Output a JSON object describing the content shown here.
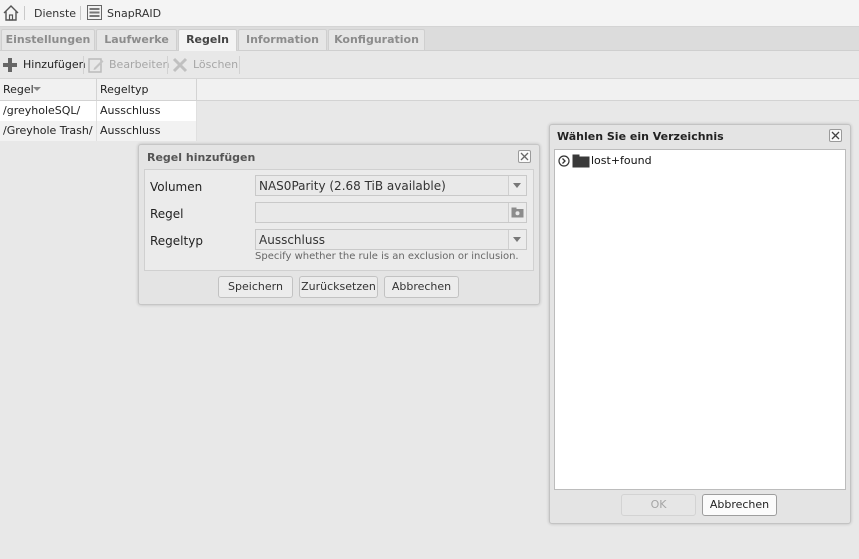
{
  "topbar": {
    "home_icon": "home-icon",
    "breadcrumbs": [
      "Dienste",
      "SnapRAID"
    ],
    "snapraid_icon": "snapraid-icon"
  },
  "tabs": [
    {
      "label": "Einstellungen",
      "active": false
    },
    {
      "label": "Laufwerke",
      "active": false
    },
    {
      "label": "Regeln",
      "active": true
    },
    {
      "label": "Information",
      "active": false
    },
    {
      "label": "Konfiguration",
      "active": false
    }
  ],
  "toolbar": {
    "add_label": "Hinzufügen",
    "edit_label": "Bearbeiten",
    "delete_label": "Löschen",
    "edit_disabled": true,
    "delete_disabled": true
  },
  "grid": {
    "columns": [
      "Regel",
      "Regeltyp"
    ],
    "sort_column": "Regel",
    "rows": [
      [
        "/greyholeSQL/",
        "Ausschluss"
      ],
      [
        "/Greyhole Trash/",
        "Ausschluss"
      ]
    ]
  },
  "add_rule_dialog": {
    "title": "Regel hinzufügen",
    "fields": {
      "volume_label": "Volumen",
      "volume_value": "NAS0Parity (2.68 TiB available)",
      "rule_label": "Regel",
      "rule_value": "",
      "ruletype_label": "Regeltyp",
      "ruletype_value": "Ausschluss",
      "ruletype_hint": "Specify whether the rule is an exclusion or inclusion."
    },
    "buttons": {
      "save": "Speichern",
      "reset": "Zurücksetzen",
      "cancel": "Abbrechen"
    }
  },
  "dir_dialog": {
    "title": "Wählen Sie ein Verzeichnis",
    "tree": [
      {
        "name": "lost+found",
        "expanded": false
      }
    ],
    "buttons": {
      "ok": "OK",
      "cancel": "Abbrechen",
      "ok_disabled": true
    }
  },
  "colors": {
    "background": "#e8e8e8",
    "active_tab_text": "#444444",
    "inactive_tab_text": "#8c8c8c",
    "disabled_text": "#a6a6a6"
  }
}
